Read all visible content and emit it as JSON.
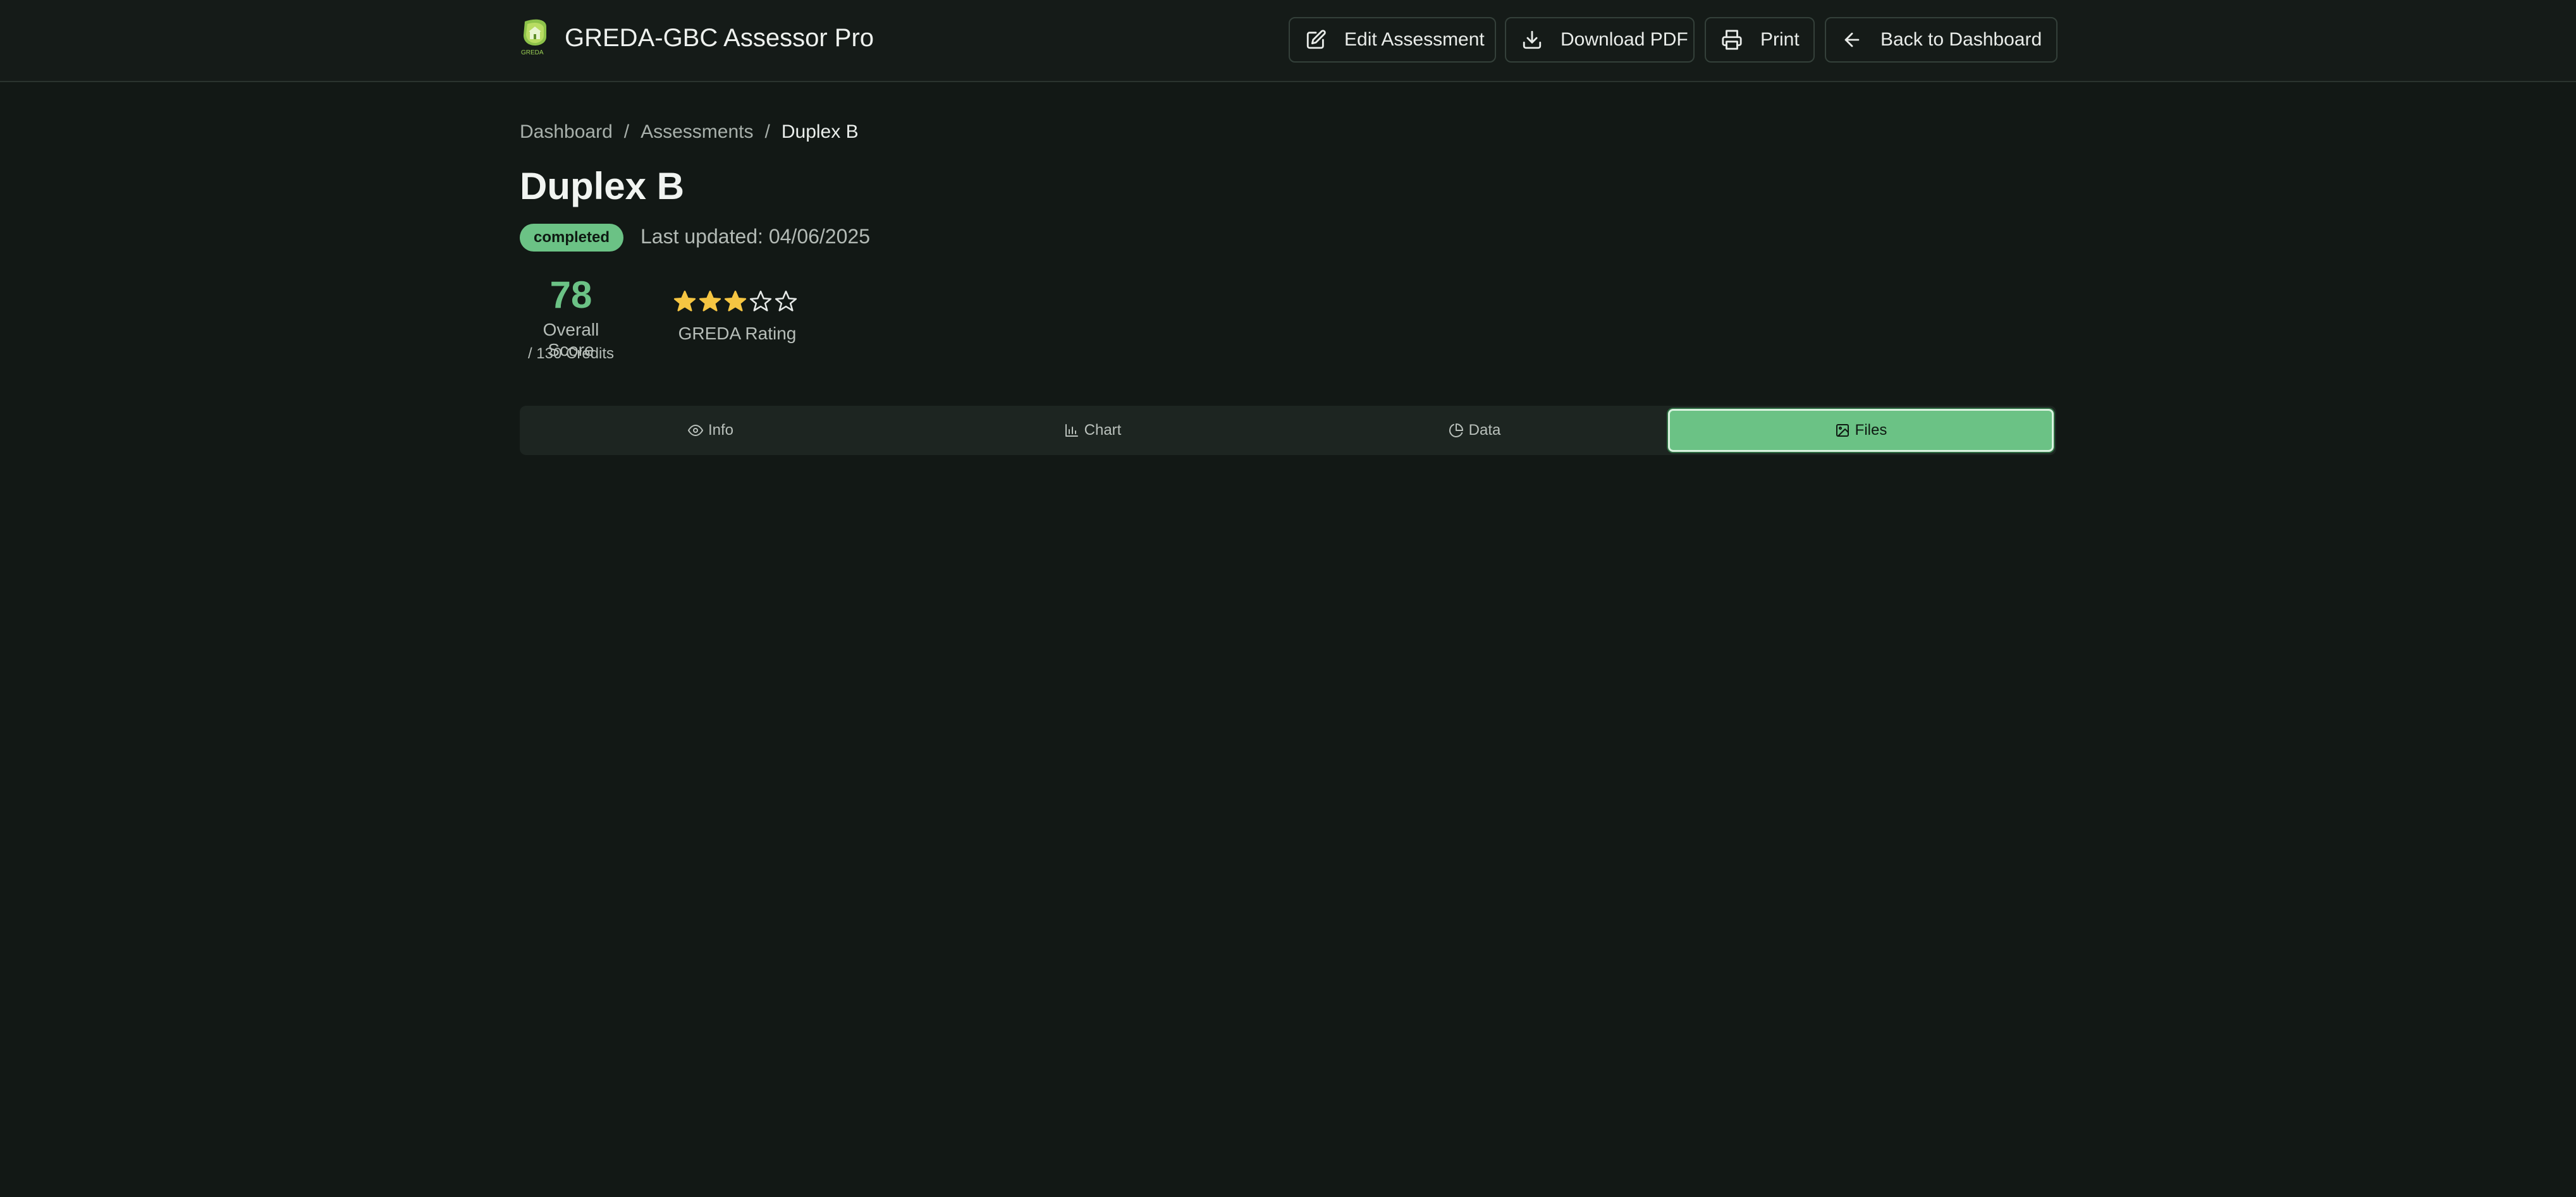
{
  "header": {
    "app_title": "GREDA-GBC Assessor Pro",
    "logo_text": "GREDA",
    "buttons": {
      "edit": "Edit Assessment",
      "download": "Download PDF",
      "print": "Print",
      "back": "Back to Dashboard"
    }
  },
  "breadcrumb": {
    "items": [
      "Dashboard",
      "Assessments",
      "Duplex B"
    ],
    "separator": "/"
  },
  "page": {
    "title": "Duplex B",
    "status": "completed",
    "last_updated": "Last updated: 04/06/2025"
  },
  "score": {
    "value": "78",
    "label": "Overall Score",
    "credits": "/ 130 Credits"
  },
  "rating": {
    "stars_filled": 3,
    "stars_total": 5,
    "label": "GREDA Rating"
  },
  "tabs": [
    {
      "label": "Info",
      "icon": "eye-icon"
    },
    {
      "label": "Chart",
      "icon": "bar-chart-icon"
    },
    {
      "label": "Data",
      "icon": "pie-chart-icon"
    },
    {
      "label": "Files",
      "icon": "image-icon",
      "active": true
    }
  ],
  "colors": {
    "accent": "#6bc285",
    "background": "#121815",
    "star": "#f5c542"
  }
}
